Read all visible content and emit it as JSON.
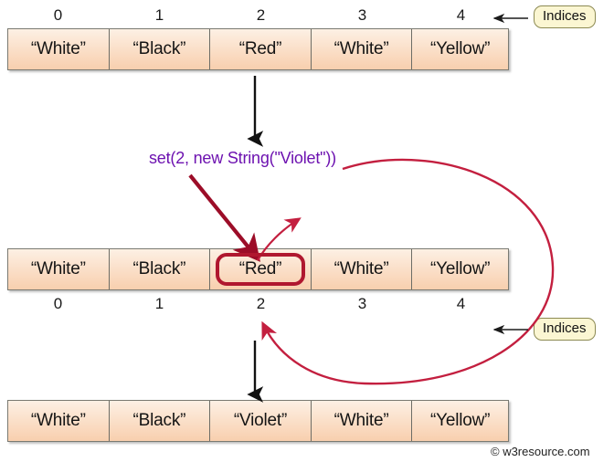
{
  "diagram": {
    "title": "ArrayList set(2, new String(\"Violet\")) operation",
    "colors": {
      "cell_fill_top": "#fdf0e4",
      "cell_fill_bottom": "#f8cfae",
      "cell_border": "#6d6d66",
      "highlight_border": "#b0172f",
      "curve": "#c31f3f",
      "straight_arrow": "#9c0d28",
      "black_arrow": "#121212",
      "callout_fill": "#fbf6d2",
      "callout_border": "#8c8a53",
      "set_text": "#6d12b0"
    }
  },
  "arrays": [
    {
      "id": "array-before",
      "cells": [
        "“White”",
        "“Black”",
        "“Red”",
        "“White”",
        "“Yellow”"
      ],
      "highlight_index": null,
      "indices": [
        "0",
        "1",
        "2",
        "3",
        "4"
      ],
      "indices_position": "above"
    },
    {
      "id": "array-during",
      "cells": [
        "“White”",
        "“Black”",
        "“Red”",
        "“White”",
        "“Yellow”"
      ],
      "highlight_index": 2,
      "indices": [
        "0",
        "1",
        "2",
        "3",
        "4"
      ],
      "indices_position": "below"
    },
    {
      "id": "array-after",
      "cells": [
        "“White”",
        "“Black”",
        "“Violet”",
        "“White”",
        "“Yellow”"
      ],
      "highlight_index": null,
      "indices": [],
      "indices_position": "none"
    }
  ],
  "callouts": {
    "top": {
      "label": "Indices"
    },
    "bottom": {
      "label": "Indices"
    }
  },
  "operation": {
    "label": "set(2, new String(\"Violet\"))"
  },
  "watermark": {
    "label": "© w3resource.com"
  }
}
